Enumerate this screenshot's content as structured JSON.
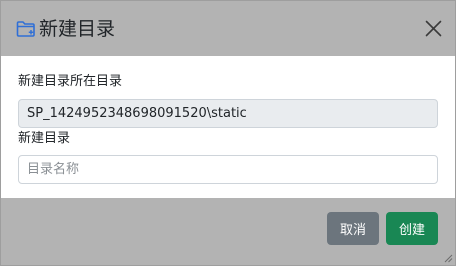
{
  "dialog": {
    "title": "新建目录",
    "icon": "folder-plus-icon",
    "close_icon": "close-icon"
  },
  "form": {
    "parent_label": "新建目录所在目录",
    "parent_value": "SP_1424952348698091520\\static",
    "name_label": "新建目录",
    "name_value": "",
    "name_placeholder": "目录名称"
  },
  "footer": {
    "cancel_label": "取消",
    "create_label": "创建"
  },
  "colors": {
    "header_bg": "#b3b3b3",
    "footer_bg": "#b3b3b3",
    "icon_accent": "#2f6fd6",
    "cancel_bg": "#6c757d",
    "create_bg": "#198754",
    "readonly_bg": "#e9ecef"
  }
}
